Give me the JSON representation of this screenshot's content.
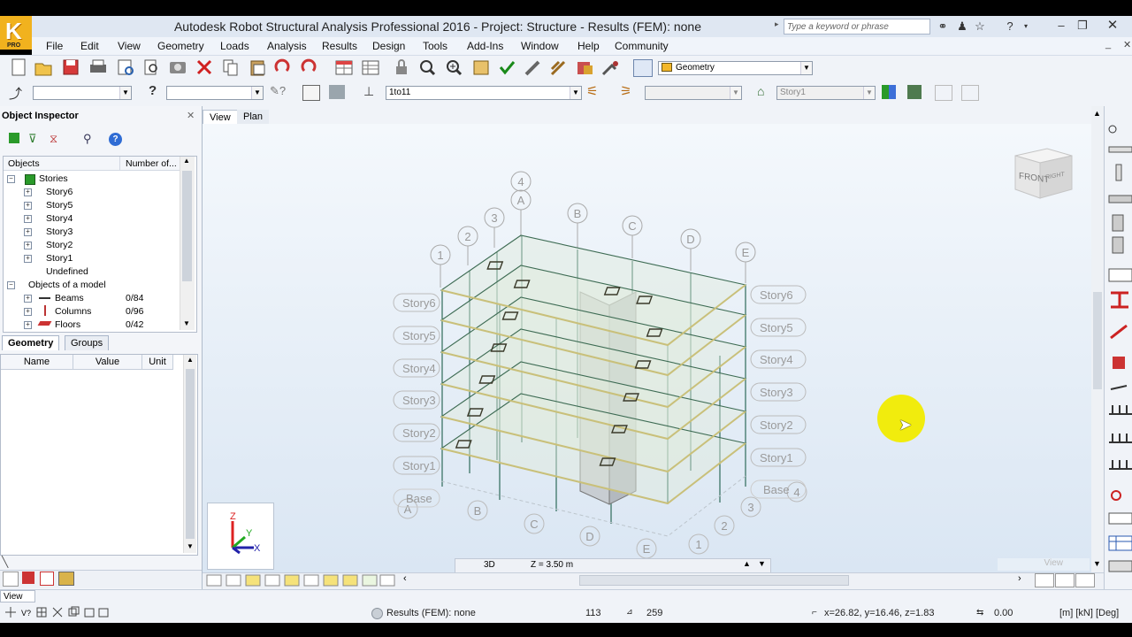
{
  "window": {
    "title": "Autodesk Robot Structural Analysis Professional 2016 - Project: Structure - Results (FEM): none",
    "search_placeholder": "Type a keyword or phrase",
    "logo_letter": "K",
    "logo_sub": "PRO"
  },
  "menu": [
    "File",
    "Edit",
    "View",
    "Geometry",
    "Loads",
    "Analysis",
    "Results",
    "Design",
    "Tools",
    "Add-Ins",
    "Window",
    "Help",
    "Community"
  ],
  "toolbar": {
    "layout_combo": "Geometry",
    "cases_combo": "1to11",
    "story_combo": "Story1"
  },
  "inspector": {
    "title": "Object Inspector",
    "col_objects": "Objects",
    "col_number": "Number of...",
    "stories_label": "Stories",
    "stories": [
      "Story6",
      "Story5",
      "Story4",
      "Story3",
      "Story2",
      "Story1"
    ],
    "undefined_label": "Undefined",
    "objects_of_model": "Objects of a model",
    "model_items": [
      {
        "name": "Beams",
        "count": "0/84"
      },
      {
        "name": "Columns",
        "count": "0/96"
      },
      {
        "name": "Floors",
        "count": "0/42"
      }
    ],
    "tabs": [
      "Geometry",
      "Groups"
    ],
    "prop_headers": [
      "Name",
      "Value",
      "Unit"
    ]
  },
  "view": {
    "tabs": [
      "View",
      "Plan"
    ],
    "mode": "3D",
    "z_level": "Z = 3.50 m",
    "watermark": "View",
    "cube_front": "FRONT",
    "cube_right": "RIGHT",
    "axes": {
      "x": "X",
      "y": "Y",
      "z": "Z"
    },
    "grid_top_numbers": [
      "1",
      "2",
      "3",
      "4"
    ],
    "grid_top_letters": [
      "A",
      "B",
      "C",
      "D",
      "E"
    ],
    "grid_bottom_letters": [
      "A",
      "B",
      "C",
      "D",
      "E"
    ],
    "grid_bottom_numbers": [
      "1",
      "2",
      "3",
      "4"
    ],
    "story_labels_left": [
      "Story6",
      "Story5",
      "Story4",
      "Story3",
      "Story2",
      "Story1",
      "Base"
    ],
    "story_labels_right": [
      "Story6",
      "Story5",
      "Story4",
      "Story3",
      "Story2",
      "Story1",
      "Base"
    ]
  },
  "status": {
    "bottom_left_view": "View",
    "results": "Results (FEM): none",
    "num1": "113",
    "num2": "259",
    "coords": "x=26.82, y=16.46, z=1.83",
    "angle": "0.00",
    "units": "[m] [kN] [Deg]"
  },
  "colors": {
    "accent": "#f1b21e",
    "view_bg_top": "#f4f8fc",
    "view_bg_bottom": "#dae6f3",
    "cursor_highlight": "#f1ec00"
  }
}
